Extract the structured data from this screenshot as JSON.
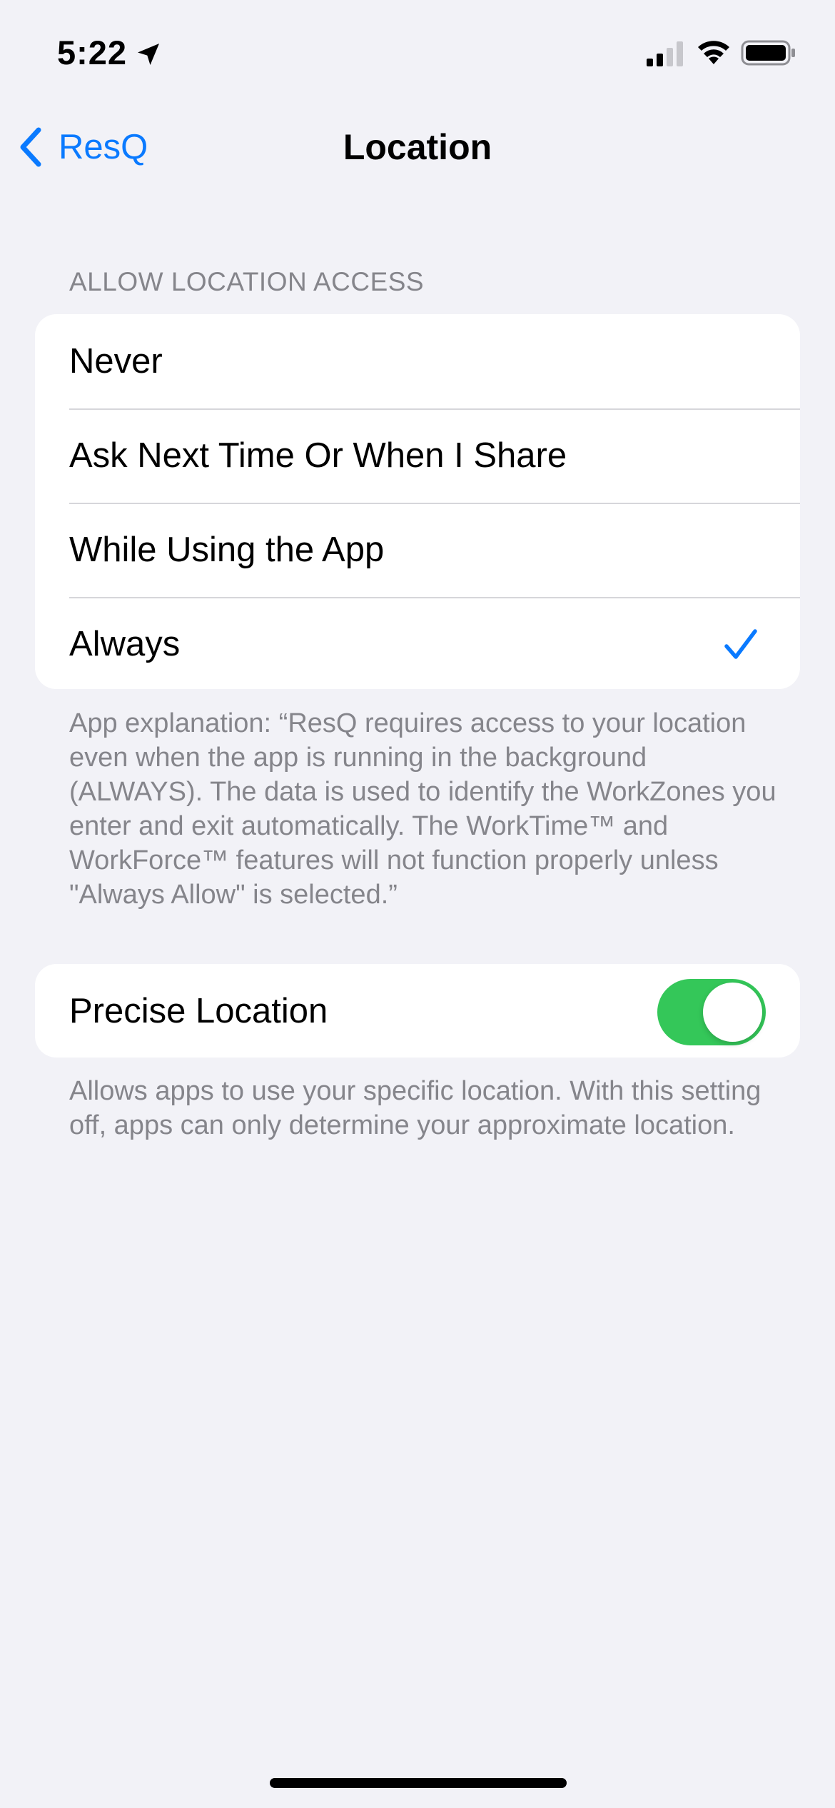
{
  "status_bar": {
    "time": "5:22",
    "icons": [
      "location-arrow-icon",
      "cellular-signal-icon",
      "wifi-icon",
      "battery-icon"
    ]
  },
  "nav": {
    "back_label": "ResQ",
    "title": "Location"
  },
  "access_section": {
    "header": "ALLOW LOCATION ACCESS",
    "options": [
      {
        "label": "Never",
        "selected": false
      },
      {
        "label": "Ask Next Time Or When I Share",
        "selected": false
      },
      {
        "label": "While Using the App",
        "selected": false
      },
      {
        "label": "Always",
        "selected": true
      }
    ],
    "footer": "App explanation: “ResQ requires access to your location even when the app is running in the background (ALWAYS). The data is used to identify the WorkZones you enter and exit automatically. The WorkTime™ and WorkForce™ features will not function properly unless \"Always Allow\" is selected.”"
  },
  "precise_section": {
    "label": "Precise Location",
    "enabled": true,
    "footer": "Allows apps to use your specific location. With this setting off, apps can only determine your approximate location."
  },
  "colors": {
    "accent": "#0a7aff",
    "toggle_on": "#34c759",
    "background": "#f2f2f7",
    "secondary_text": "#85858b"
  }
}
